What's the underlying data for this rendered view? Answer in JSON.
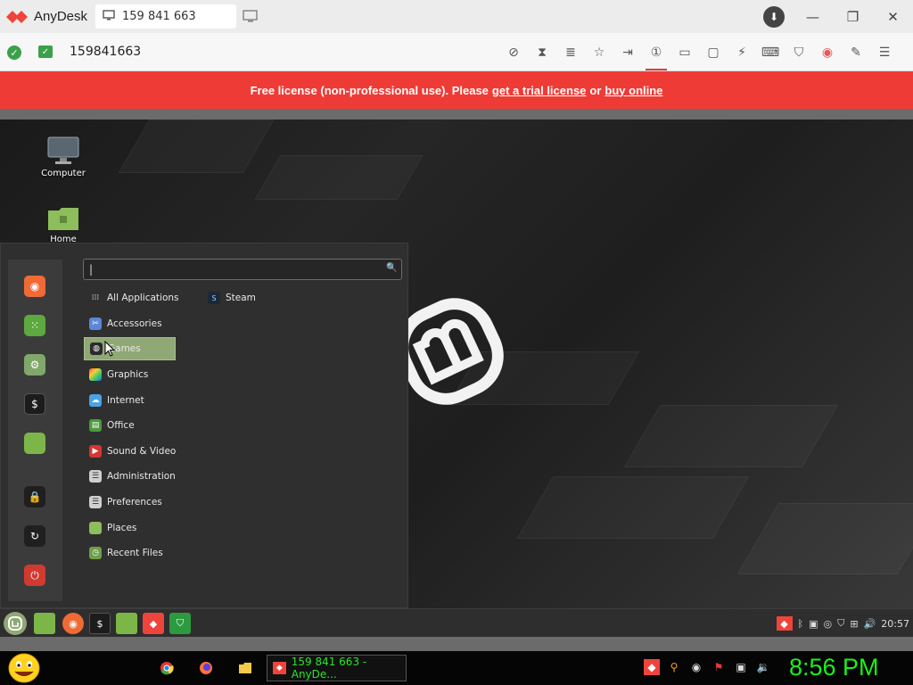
{
  "app": {
    "name": "AnyDesk",
    "session_tab": "159 841 663",
    "address": "159841663"
  },
  "banner": {
    "text": "Free license (non-professional use). Please",
    "link1": "get a trial license",
    "or": "or",
    "link2": "buy online"
  },
  "desktop": {
    "icons": [
      {
        "label": "Computer"
      },
      {
        "label": "Home"
      }
    ]
  },
  "menu": {
    "search_value": "|",
    "categories": [
      {
        "label": "All Applications"
      },
      {
        "label": "Accessories"
      },
      {
        "label": "Games"
      },
      {
        "label": "Graphics"
      },
      {
        "label": "Internet"
      },
      {
        "label": "Office"
      },
      {
        "label": "Sound & Video"
      },
      {
        "label": "Administration"
      },
      {
        "label": "Preferences"
      },
      {
        "label": "Places"
      },
      {
        "label": "Recent Files"
      }
    ],
    "selected_category": "Games",
    "apps": [
      {
        "label": "Steam"
      }
    ]
  },
  "panel": {
    "clock": "20:57"
  },
  "windows_taskbar": {
    "task_label": "159 841 663 - AnyDe...",
    "clock": "8:56 PM"
  },
  "colors": {
    "banner": "#ef3b36",
    "anydesk_red": "#ef443b",
    "mint_green": "#8fa876",
    "clock_green": "#19f219"
  }
}
